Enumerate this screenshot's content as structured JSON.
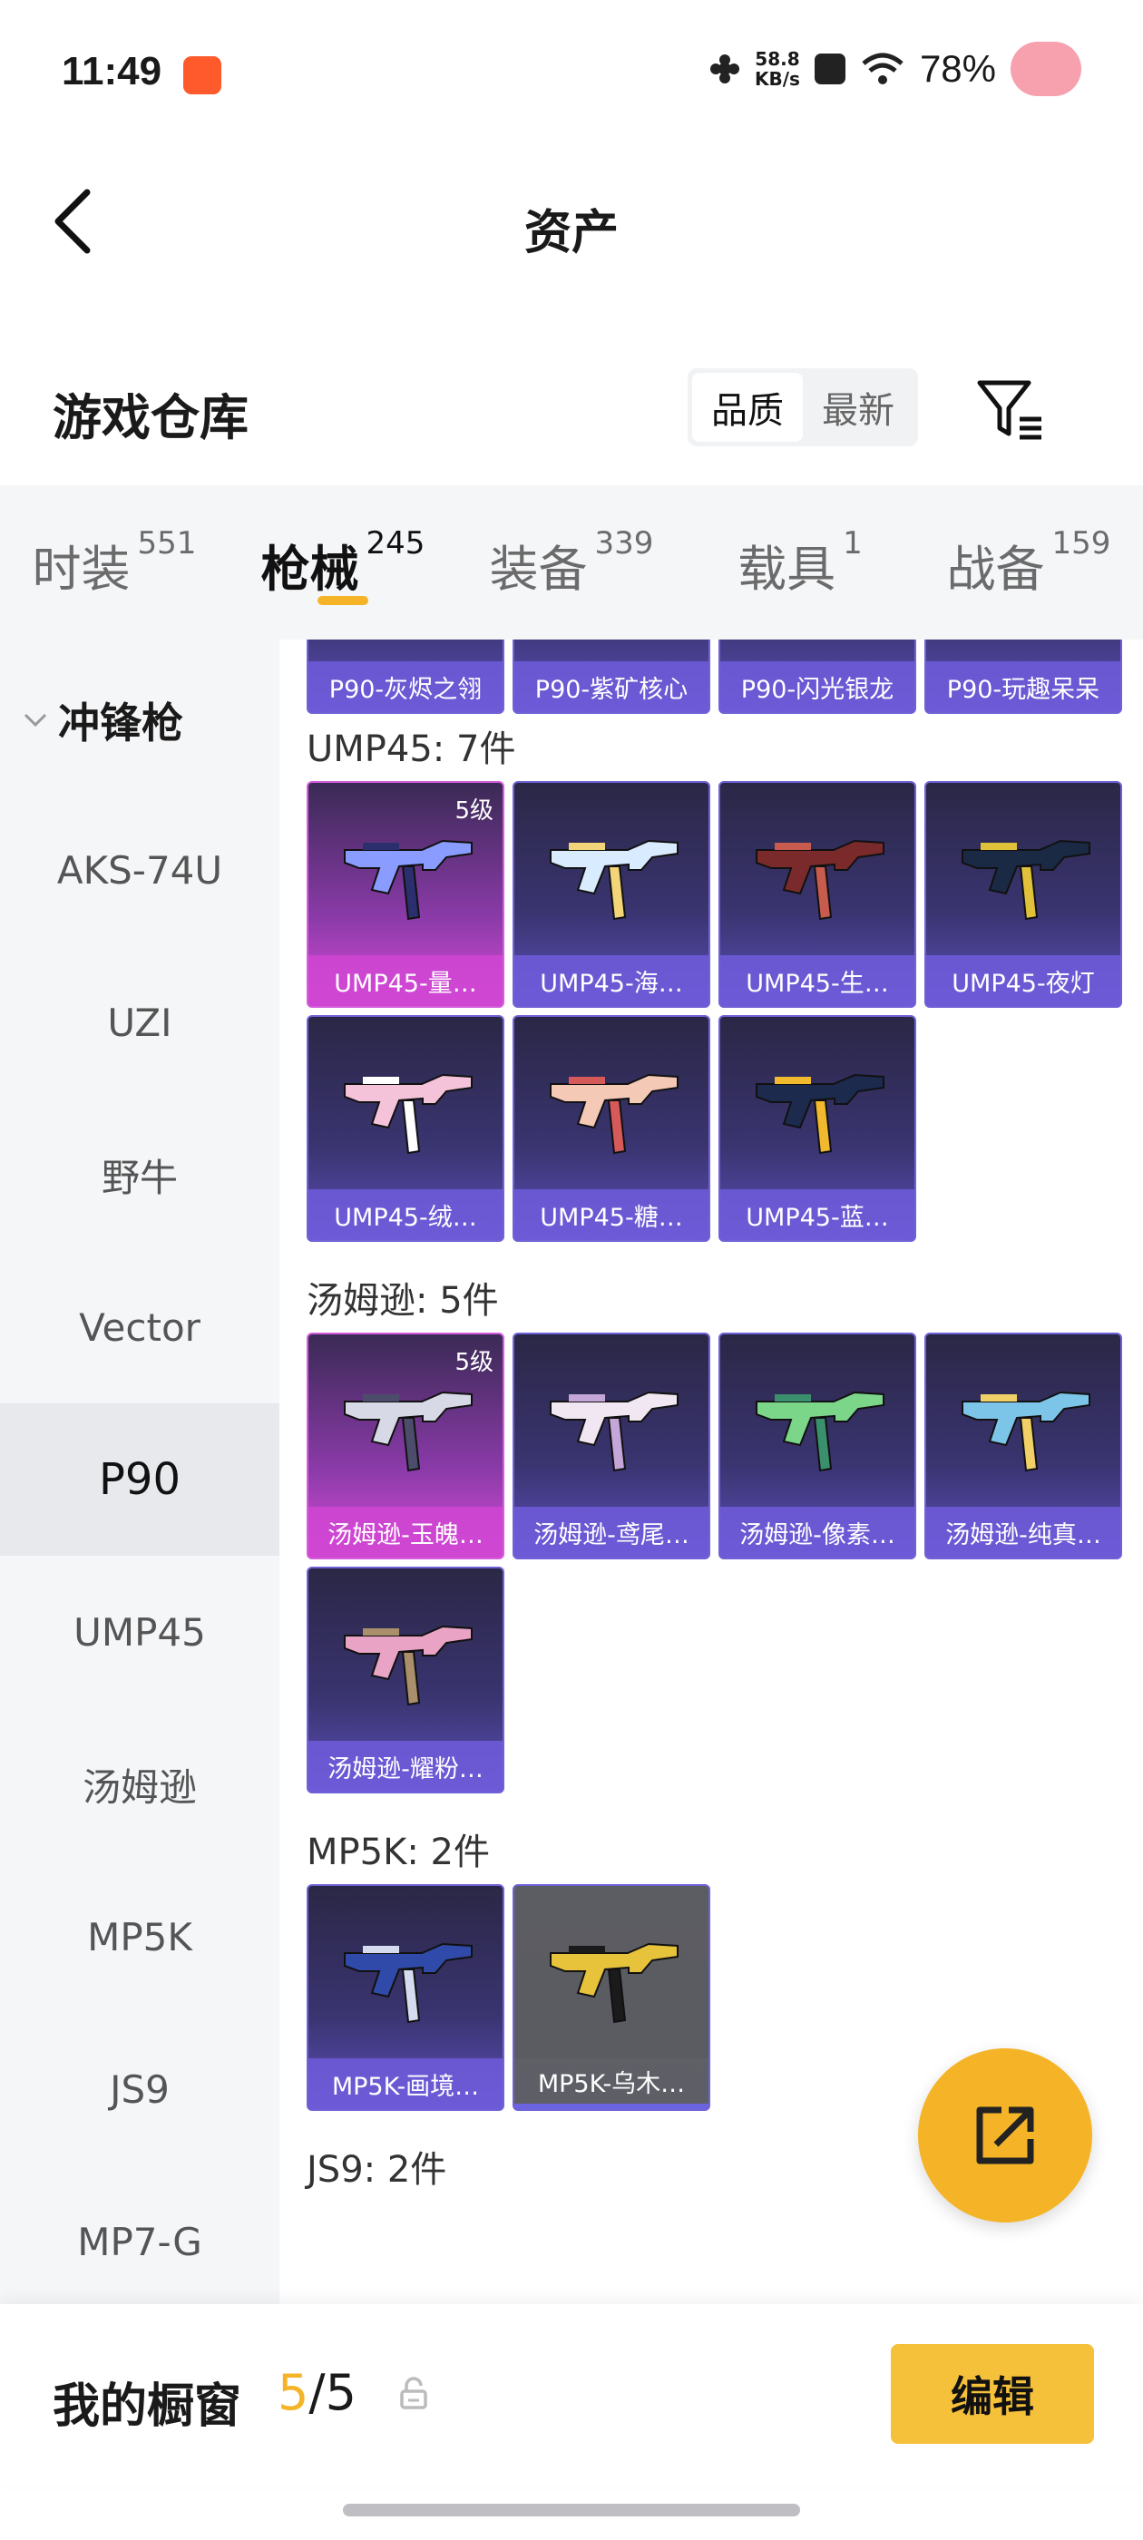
{
  "status_bar": {
    "time": "11:49",
    "net_speed_value": "58.8",
    "net_speed_unit": "KB/s",
    "battery": "78%"
  },
  "header": {
    "title": "资产"
  },
  "warehouse": {
    "title": "游戏仓库",
    "sort_options": [
      "品质",
      "最新"
    ],
    "sort_selected": "品质"
  },
  "tabs": [
    {
      "label": "时装",
      "count": "551"
    },
    {
      "label": "枪械",
      "count": "245",
      "active": true
    },
    {
      "label": "装备",
      "count": "339"
    },
    {
      "label": "载具",
      "count": "1"
    },
    {
      "label": "战备",
      "count": "159"
    }
  ],
  "sidebar": {
    "category": "冲锋枪",
    "items": [
      "AKS-74U",
      "UZI",
      "野牛",
      "Vector",
      "P90",
      "UMP45",
      "汤姆逊",
      "MP5K",
      "JS9",
      "MP7-G"
    ],
    "active": "P90"
  },
  "main": {
    "p90_items": [
      "P90-灰烬之翎",
      "P90-紫矿核心",
      "P90-闪光银龙",
      "P90-玩趣呆呆"
    ],
    "sections": [
      {
        "title": "UMP45: 7件",
        "items": [
          {
            "name": "UMP45-量…",
            "level": "5级",
            "quality": "gold",
            "colors": [
              "#8a9cff",
              "#2b2f6e"
            ]
          },
          {
            "name": "UMP45-海…",
            "quality": "purple",
            "colors": [
              "#d9ecff",
              "#f2d479"
            ]
          },
          {
            "name": "UMP45-生…",
            "quality": "purple",
            "colors": [
              "#7a2a2a",
              "#c75b4d"
            ]
          },
          {
            "name": "UMP45-夜灯",
            "quality": "purple",
            "colors": [
              "#1a2a45",
              "#e0c23a"
            ]
          },
          {
            "name": "UMP45-绒…",
            "quality": "purple",
            "colors": [
              "#f5c3d9",
              "#ffffff"
            ]
          },
          {
            "name": "UMP45-糖…",
            "quality": "purple",
            "colors": [
              "#f4c9b6",
              "#d75a5a"
            ]
          },
          {
            "name": "UMP45-蓝…",
            "quality": "purple",
            "colors": [
              "#1c2a4d",
              "#f0b92e"
            ]
          }
        ]
      },
      {
        "title": "汤姆逊: 5件",
        "items": [
          {
            "name": "汤姆逊-玉魄…",
            "level": "5级",
            "quality": "gold",
            "colors": [
              "#d7d9e6",
              "#4b4d6b"
            ]
          },
          {
            "name": "汤姆逊-鸢尾…",
            "quality": "purple",
            "colors": [
              "#f1e7f2",
              "#c4a6d8"
            ]
          },
          {
            "name": "汤姆逊-像素…",
            "quality": "purple",
            "colors": [
              "#7bd68a",
              "#3a8f6d"
            ]
          },
          {
            "name": "汤姆逊-纯真…",
            "quality": "purple",
            "colors": [
              "#7cc5e8",
              "#f1d067"
            ]
          },
          {
            "name": "汤姆逊-耀粉…",
            "quality": "purple",
            "colors": [
              "#e8a3c5",
              "#a98f6b"
            ]
          }
        ]
      },
      {
        "title": "MP5K: 2件",
        "items": [
          {
            "name": "MP5K-画境…",
            "quality": "purple",
            "colors": [
              "#2f4aa8",
              "#d6dcef"
            ]
          },
          {
            "name": "MP5K-乌木…",
            "quality": "gray",
            "colors": [
              "#e7c23b",
              "#1b1b1b"
            ]
          }
        ]
      },
      {
        "title": "JS9: 2件",
        "items": []
      }
    ]
  },
  "bottom_bar": {
    "label": "我的橱窗",
    "count_current": "5",
    "count_sep": "/",
    "count_total": "5",
    "edit_label": "编辑"
  },
  "colors": {
    "accent": "#f5b427",
    "card_purple": "#6f62d6",
    "card_gold": "#d45ddc"
  }
}
